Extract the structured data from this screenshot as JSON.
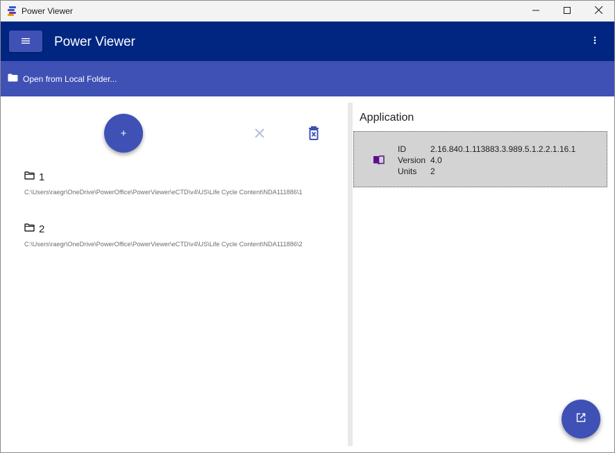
{
  "window": {
    "title": "Power Viewer",
    "controls": {
      "minimize_icon": "minimize-icon",
      "maximize_icon": "maximize-icon",
      "close_icon": "close-icon"
    }
  },
  "appbar": {
    "title": "Power Viewer",
    "menu_icon": "hamburger-menu-icon",
    "more_icon": "more-vertical-icon",
    "color": "#002682"
  },
  "toolbar": {
    "open_label": "Open from Local Folder...",
    "open_icon": "folder-icon",
    "color": "#3f51b5"
  },
  "left_panel": {
    "add_label": "+",
    "clear_icon": "close-icon",
    "delete_icon": "delete-icon",
    "folders": [
      {
        "name": "1",
        "path": "C:\\Users\\raegr\\OneDrive\\PowerOffice\\PowerViewer\\eCTD\\v4\\US\\Life Cycle Content\\NDA111886\\1"
      },
      {
        "name": "2",
        "path": "C:\\Users\\raegr\\OneDrive\\PowerOffice\\PowerViewer\\eCTD\\v4\\US\\Life Cycle Content\\NDA111886\\2"
      }
    ]
  },
  "right_panel": {
    "title": "Application",
    "card": {
      "icon": "book-icon",
      "labels": {
        "id": "ID",
        "version": "Version",
        "units": "Units"
      },
      "values": {
        "id": "2.16.840.1.113883.3.989.5.1.2.2.1.16.1",
        "version": "4.0",
        "units": "2"
      }
    }
  },
  "fab_open_icon": "open-in-new-icon",
  "accent": "#3f51b5"
}
